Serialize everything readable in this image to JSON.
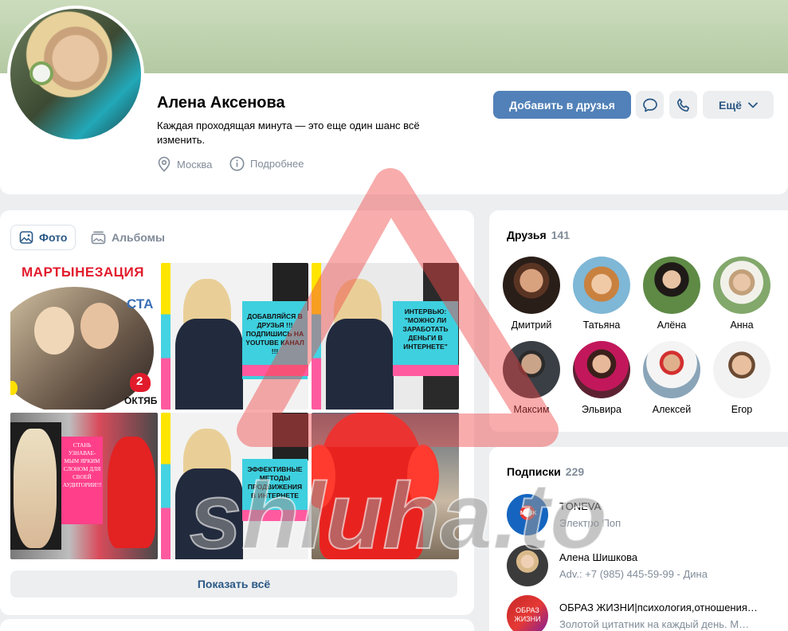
{
  "profile": {
    "name": "Алена Аксенова",
    "status": "Каждая проходящая минута — это еще один шанс всё изменить.",
    "location": "Москва",
    "details_label": "Подробнее",
    "add_friend_label": "Добавить в друзья",
    "more_label": "Ещё"
  },
  "photos": {
    "tab_photos": "Фото",
    "tab_albums": "Альбомы",
    "show_all": "Показать всё",
    "captions": {
      "p1_title": "МАРТЫНЕЗАЦИЯ",
      "p1_side": "СТА",
      "p1_date": "ОКТЯБ",
      "p1_num": "2",
      "p2": "ДОБАВЛЯЙСЯ В ДРУЗЬЯ !!! ПОДПИШИСЬ НА YOUTUBE КАНАЛ !!!",
      "p3": "ИНТЕРВЬЮ: \"МОЖНО ЛИ ЗАРАБОТАТЬ ДЕНЬГИ В ИНТЕРНЕТЕ\"",
      "p4": "СТАНЬ УЗНАВАЕ- МЫМ ЯРКИМ СЛОНОМ ДЛЯ СВОЕЙ АУДИТОРИИ!!!",
      "p5": "ЭФФЕКТИВНЫЕ МЕТОДЫ ПРОДВИЖЕНИЯ В ИНТЕРНЕТЕ"
    }
  },
  "friends": {
    "title": "Друзья",
    "count": "141",
    "items": [
      {
        "name": "Дмитрий"
      },
      {
        "name": "Татьяна"
      },
      {
        "name": "Алёна"
      },
      {
        "name": "Анна"
      },
      {
        "name": "Максим"
      },
      {
        "name": "Эльвира"
      },
      {
        "name": "Алексей"
      },
      {
        "name": "Егор"
      }
    ]
  },
  "subscriptions": {
    "title": "Подписки",
    "count": "229",
    "items": [
      {
        "name": "TONEVA",
        "desc": "Электро Поп",
        "avatar_text": "MASK"
      },
      {
        "name": "Алена Шишкова",
        "desc": "Adv.: +7 (985) 445-59-99 - Дина",
        "avatar_text": ""
      },
      {
        "name": "ОБРАЗ ЖИЗНИ|психология,отношения…",
        "desc": "Золотой цитатник на каждый день. М…",
        "avatar_text": "ОБРАЗ ЖИЗНИ"
      }
    ]
  },
  "watermark": {
    "text": "shluha.to"
  },
  "colors": {
    "accent": "#5181b8",
    "link": "#2a5885",
    "muted": "#818c99",
    "bg": "#edeef0"
  }
}
